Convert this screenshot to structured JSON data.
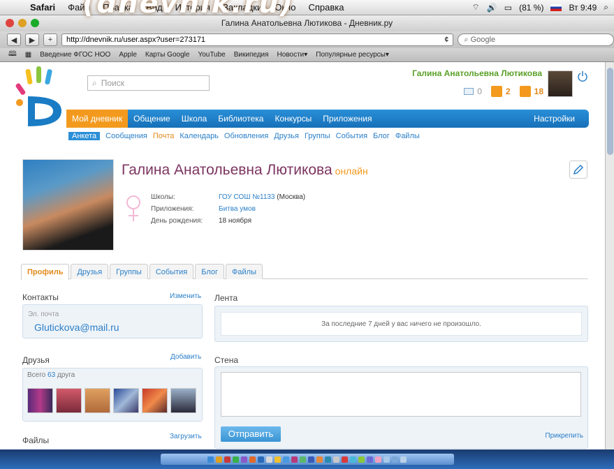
{
  "slide_title": "(dnevnik.ru)",
  "mac_menu": {
    "app": "Safari",
    "items": [
      "Файл",
      "Правка",
      "Вид",
      "История",
      "Закладки",
      "Окно",
      "Справка"
    ],
    "battery": "(81 %)",
    "clock": "Вт 9:49"
  },
  "window": {
    "title": "Галина Анатольевна Лютикова - Дневник.ру"
  },
  "toolbar": {
    "url": "http://dnevnik.ru/user.aspx?user=273171",
    "search_placeholder": "Google"
  },
  "bookmarks": [
    "Введение ФГОС НОО",
    "Apple",
    "Карты Google",
    "YouTube",
    "Википедия",
    "Новости▾",
    "Популярные ресурсы▾"
  ],
  "header": {
    "search_placeholder": "Поиск",
    "user_name": "Галина Анатольевна Лютикова",
    "mail_count": "0",
    "friends_count": "2",
    "events_count": "18"
  },
  "nav": {
    "items": [
      "Мой дневник",
      "Общение",
      "Школа",
      "Библиотека",
      "Конкурсы",
      "Приложения"
    ],
    "settings": "Настройки"
  },
  "subnav": {
    "items": [
      "Анкета",
      "Сообщения",
      "Почта",
      "Календарь",
      "Обновления",
      "Друзья",
      "Группы",
      "События",
      "Блог",
      "Файлы"
    ]
  },
  "profile": {
    "name": "Галина Анатольевна Лютикова",
    "status": "онлайн",
    "schools_label": "Школы:",
    "school_name": "ГОУ СОШ №1133",
    "school_city": "(Москва)",
    "apps_label": "Приложения:",
    "app_name": "Битва умов",
    "birthday_label": "День рождения:",
    "birthday": "18 ноября"
  },
  "tabs": [
    "Профиль",
    "Друзья",
    "Группы",
    "События",
    "Блог",
    "Файлы"
  ],
  "contacts": {
    "title": "Контакты",
    "edit": "Изменить",
    "email_label": "Эл. почта",
    "email": "Glutickova@mail.ru"
  },
  "friends": {
    "title": "Друзья",
    "add": "Добавить",
    "total_prefix": "Всего",
    "total_count": "63",
    "total_suffix": "друга"
  },
  "files": {
    "title": "Файлы",
    "upload": "Загрузить"
  },
  "feed": {
    "title": "Лента",
    "empty": "За последние 7 дней у вас ничего не произошло."
  },
  "wall": {
    "title": "Стена",
    "send": "Отправить",
    "attach": "Прикрепить"
  },
  "colors": {
    "nav_blue": "#1670b8",
    "accent_orange": "#f39a1e",
    "name_purple": "#7c3560",
    "user_green": "#5aa028"
  }
}
